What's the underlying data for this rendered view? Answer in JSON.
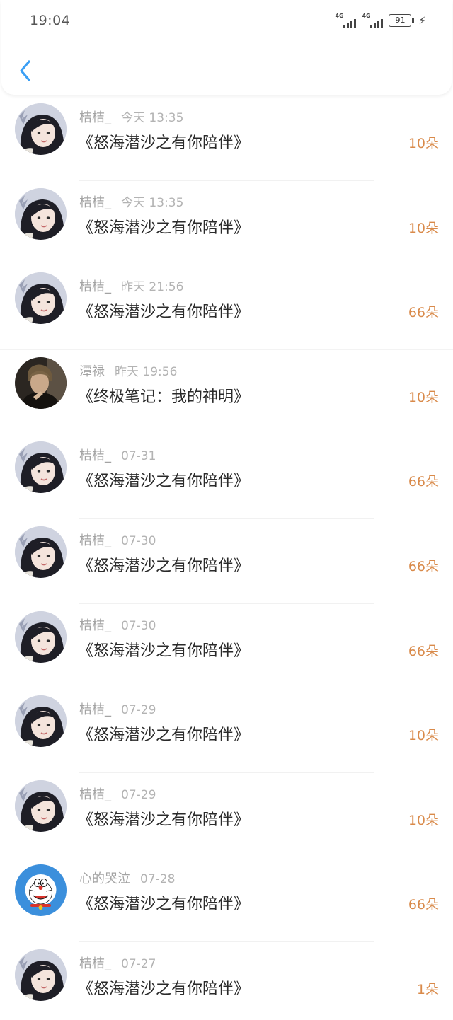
{
  "status_bar": {
    "time": "19:04",
    "net1": "4G",
    "net2": "4G",
    "battery": "91"
  },
  "header": {
    "back_icon": "chevron-left-icon",
    "accent_color": "#3b9ff5"
  },
  "gifts": [
    {
      "user": "桔桔_",
      "time": "今天 13:35",
      "book": "《怒海潜沙之有你陪伴》",
      "count": "10朵",
      "avatar": "girl"
    },
    {
      "user": "桔桔_",
      "time": "今天 13:35",
      "book": "《怒海潜沙之有你陪伴》",
      "count": "10朵",
      "avatar": "girl"
    },
    {
      "user": "桔桔_",
      "time": "昨天 21:56",
      "book": "《怒海潜沙之有你陪伴》",
      "count": "66朵",
      "avatar": "girl"
    },
    {
      "user": "潭禄",
      "time": "昨天 19:56",
      "book": "《终极笔记：我的神明》",
      "count": "10朵",
      "avatar": "man"
    },
    {
      "user": "桔桔_",
      "time": "07-31",
      "book": "《怒海潜沙之有你陪伴》",
      "count": "66朵",
      "avatar": "girl"
    },
    {
      "user": "桔桔_",
      "time": "07-30",
      "book": "《怒海潜沙之有你陪伴》",
      "count": "66朵",
      "avatar": "girl"
    },
    {
      "user": "桔桔_",
      "time": "07-30",
      "book": "《怒海潜沙之有你陪伴》",
      "count": "66朵",
      "avatar": "girl"
    },
    {
      "user": "桔桔_",
      "time": "07-29",
      "book": "《怒海潜沙之有你陪伴》",
      "count": "10朵",
      "avatar": "girl"
    },
    {
      "user": "桔桔_",
      "time": "07-29",
      "book": "《怒海潜沙之有你陪伴》",
      "count": "10朵",
      "avatar": "girl"
    },
    {
      "user": "心的哭泣",
      "time": "07-28",
      "book": "《怒海潜沙之有你陪伴》",
      "count": "66朵",
      "avatar": "doraemon"
    },
    {
      "user": "桔桔_",
      "time": "07-27",
      "book": "《怒海潜沙之有你陪伴》",
      "count": "1朵",
      "avatar": "girl"
    }
  ]
}
